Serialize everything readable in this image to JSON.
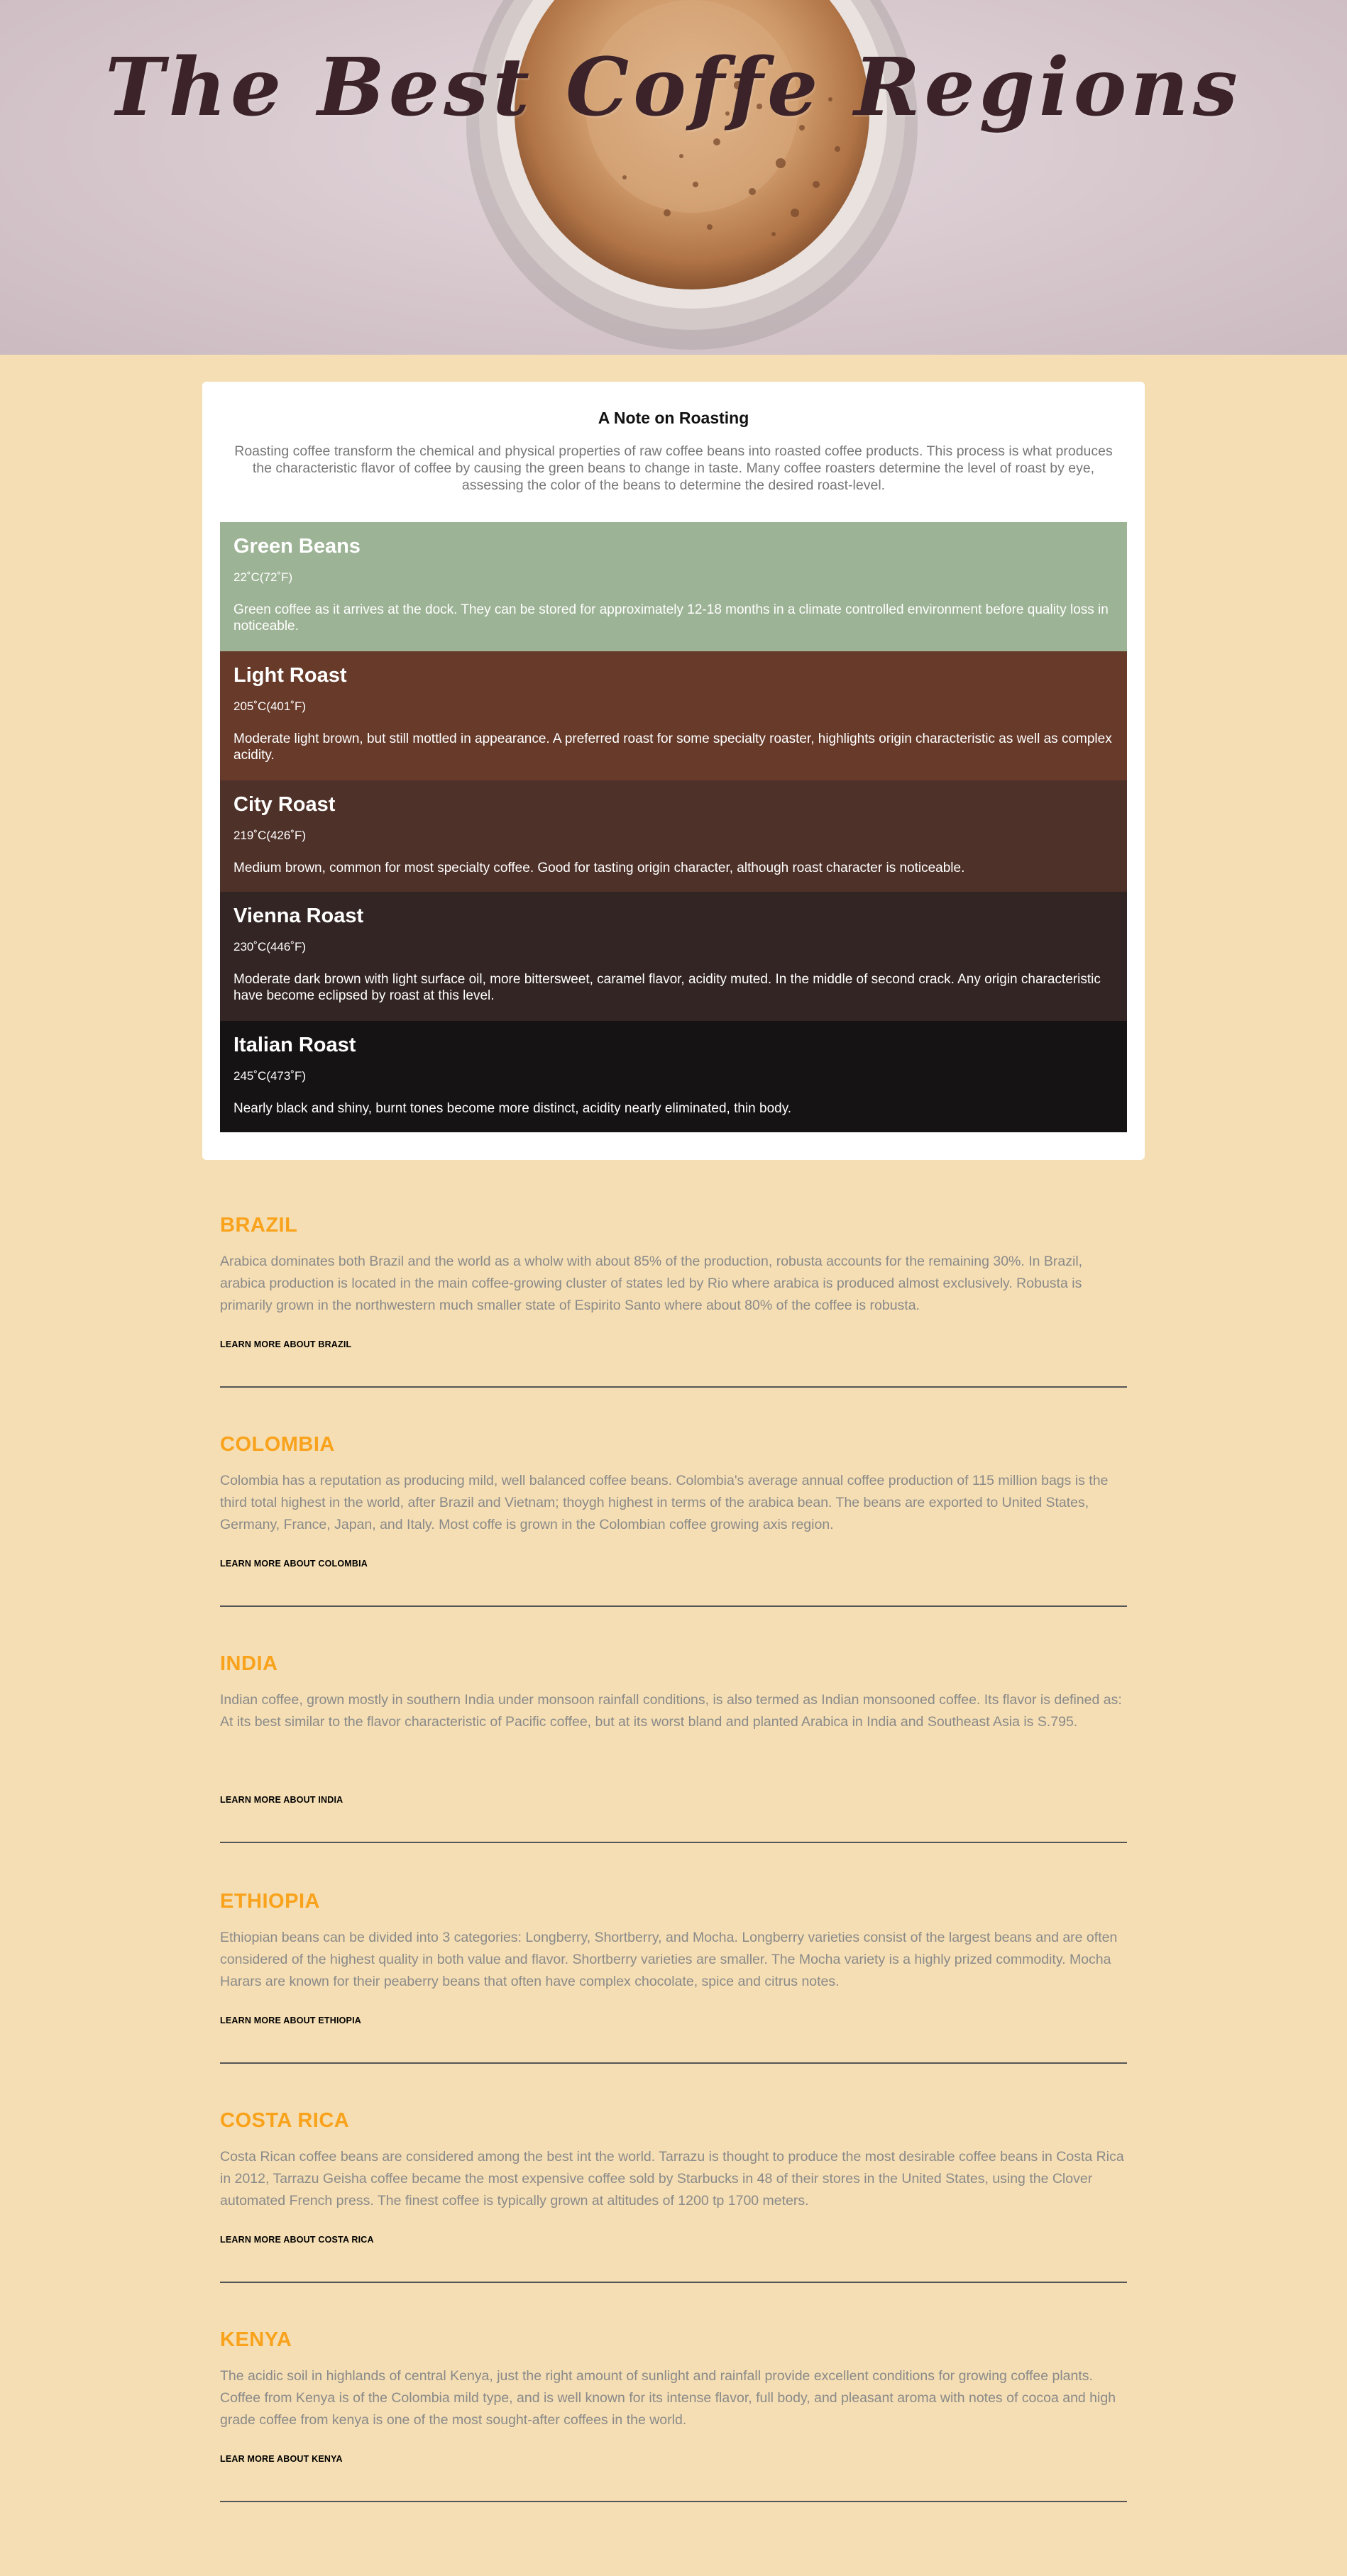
{
  "hero": {
    "title": "The Best Coffe Regions"
  },
  "roasting": {
    "title": "A Note on Roasting",
    "intro": "Roasting coffee transform the chemical and physical properties of raw coffee beans into roasted coffee products. This process is what produces the characteristic flavor of coffee by causing the green beans to change in taste. Many coffee roasters determine the level of roast by eye, assessing the color of the beans to determine the desired roast-level.",
    "stages": [
      {
        "name": "Green Beans",
        "temp": "22˚C(72˚F)",
        "desc": "Green coffee as it arrives at the dock. They can be stored for approximately 12-18 months in a climate controlled environment before quality loss in noticeable.",
        "color": "#9db395"
      },
      {
        "name": "Light Roast",
        "temp": "205˚C(401˚F)",
        "desc": "Moderate light brown, but still mottled in appearance. A preferred roast for some specialty roaster, highlights origin characteristic as well as complex acidity.",
        "color": "#673a2a"
      },
      {
        "name": "City Roast",
        "temp": "219˚C(426˚F)",
        "desc": "Medium brown, common for most specialty coffee. Good for tasting origin character, although roast character is noticeable.",
        "color": "#4e3129"
      },
      {
        "name": "Vienna Roast",
        "temp": "230˚C(446˚F)",
        "desc": "Moderate dark brown with light surface oil, more bittersweet, caramel flavor, acidity muted. In the middle of second crack. Any origin characteristic have become eclipsed by roast at this level.",
        "color": "#332524"
      },
      {
        "name": "Italian Roast",
        "temp": "245˚C(473˚F)",
        "desc": "Nearly black and shiny, burnt tones become more distinct, acidity nearly eliminated, thin body.",
        "color": "#151314"
      }
    ]
  },
  "regions": [
    {
      "name": "BRAZIL",
      "text": "Arabica dominates both Brazil and the world as a wholw with about 85% of the production, robusta accounts for the remaining 30%. In Brazil, arabica production is located in the main coffee-growing cluster of states led by Rio where arabica is produced almost exclusively. Robusta is primarily grown in the northwestern much smaller state of Espirito Santo where about 80% of the coffee is robusta.",
      "link": "LEARN MORE ABOUT BRAZIL"
    },
    {
      "name": "COLOMBIA",
      "text": "Colombia has a reputation as producing mild, well balanced coffee beans. Colombia's average annual coffee production of 115 million bags is the third total highest in the world, after Brazil and Vietnam; thoygh highest in terms of the arabica bean. The beans are exported to United States, Germany, France, Japan, and Italy. Most coffe is grown in the Colombian coffee growing axis region.",
      "link": "LEARN MORE ABOUT COLOMBIA"
    },
    {
      "name": "INDIA",
      "text": "Indian coffee, grown mostly in southern India under monsoon rainfall conditions, is also termed as Indian monsooned coffee. Its flavor is defined as: At its best similar to the flavor characteristic of Pacific coffee, but at its worst bland and planted Arabica in India and Southeast Asia is S.795.",
      "link": "LEARN MORE ABOUT INDIA"
    },
    {
      "name": "ETHIOPIA",
      "text": "Ethiopian beans can be divided into 3 categories: Longberry, Shortberry, and Mocha. Longberry varieties consist of the largest beans and are often considered of the highest quality in both value and flavor. Shortberry varieties are smaller. The Mocha variety is a highly prized commodity. Mocha Harars are known for their peaberry beans that often have complex chocolate, spice and citrus notes.",
      "link": "LEARN MORE ABOUT ETHIOPIA"
    },
    {
      "name": "COSTA RICA",
      "text": "Costa Rican coffee beans are considered among the best int the world. Tarrazu is thought to produce the most desirable coffee beans in Costa Rica in 2012, Tarrazu Geisha coffee became the most expensive coffee sold by Starbucks in 48 of their stores in the United States, using the Clover automated French press. The finest coffee is typically grown at altitudes of 1200 tp 1700 meters.",
      "link": "LEARN MORE ABOUT COSTA RICA"
    },
    {
      "name": "KENYA",
      "text": "The acidic soil in highlands of central Kenya, just the right amount of sunlight and rainfall provide excellent conditions for growing coffee plants. Coffee from Kenya is of the Colombia mild type, and is well known for its intense flavor, full body, and pleasant aroma with notes of cocoa and high grade coffee from kenya is one of the most sought-after coffees in the world.",
      "link": "LEAR MORE ABOUT KENYA"
    }
  ]
}
